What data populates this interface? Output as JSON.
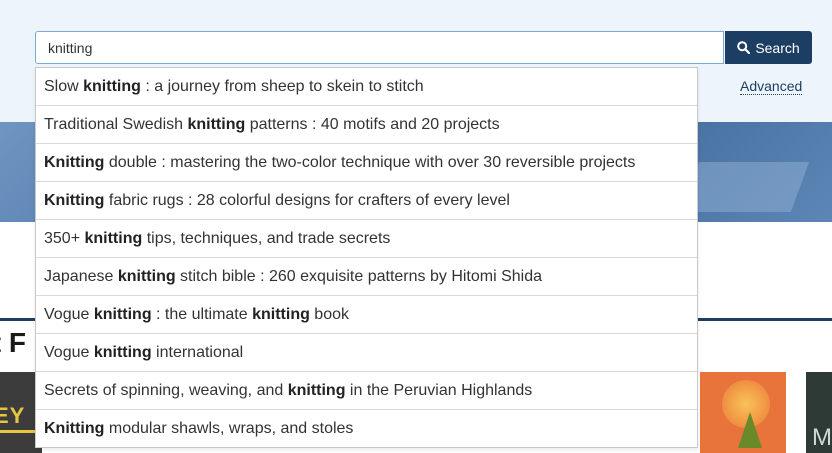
{
  "search": {
    "query": "knitting",
    "button_label": "Search",
    "advanced_label": "Advanced"
  },
  "suggestions": [
    [
      {
        "t": "Slow ",
        "b": false
      },
      {
        "t": "knitting",
        "b": true
      },
      {
        "t": " : a journey from sheep to skein to stitch",
        "b": false
      }
    ],
    [
      {
        "t": "Traditional Swedish ",
        "b": false
      },
      {
        "t": "knitting",
        "b": true
      },
      {
        "t": " patterns : 40 motifs and 20 projects",
        "b": false
      }
    ],
    [
      {
        "t": "Knitting",
        "b": true
      },
      {
        "t": " double : mastering the two-color technique with over 30 reversible projects",
        "b": false
      }
    ],
    [
      {
        "t": "Knitting",
        "b": true
      },
      {
        "t": " fabric rugs : 28 colorful designs for crafters of every level",
        "b": false
      }
    ],
    [
      {
        "t": "350+ ",
        "b": false
      },
      {
        "t": "knitting",
        "b": true
      },
      {
        "t": " tips, techniques, and trade secrets",
        "b": false
      }
    ],
    [
      {
        "t": "Japanese ",
        "b": false
      },
      {
        "t": "knitting",
        "b": true
      },
      {
        "t": " stitch bible : 260 exquisite patterns by Hitomi Shida",
        "b": false
      }
    ],
    [
      {
        "t": "Vogue ",
        "b": false
      },
      {
        "t": "knitting",
        "b": true
      },
      {
        "t": " : the ultimate ",
        "b": false
      },
      {
        "t": "knitting",
        "b": true
      },
      {
        "t": " book",
        "b": false
      }
    ],
    [
      {
        "t": "Vogue ",
        "b": false
      },
      {
        "t": "knitting",
        "b": true
      },
      {
        "t": " international",
        "b": false
      }
    ],
    [
      {
        "t": "Secrets of spinning, weaving, and ",
        "b": false
      },
      {
        "t": "knitting",
        "b": true
      },
      {
        "t": " in the Peruvian Highlands",
        "b": false
      }
    ],
    [
      {
        "t": "Knitting",
        "b": true
      },
      {
        "t": " modular shawls, wraps, and stoles",
        "b": false
      }
    ]
  ],
  "section": {
    "heading_partial": "lt F"
  },
  "covers": {
    "cover1_text": "EY",
    "cover3_text": "M"
  },
  "icons": {
    "search_button_icon": "search-icon"
  },
  "colors": {
    "primary": "#1d3e63",
    "input_border": "#7aa9d8",
    "top_band": "#eef4fb"
  }
}
